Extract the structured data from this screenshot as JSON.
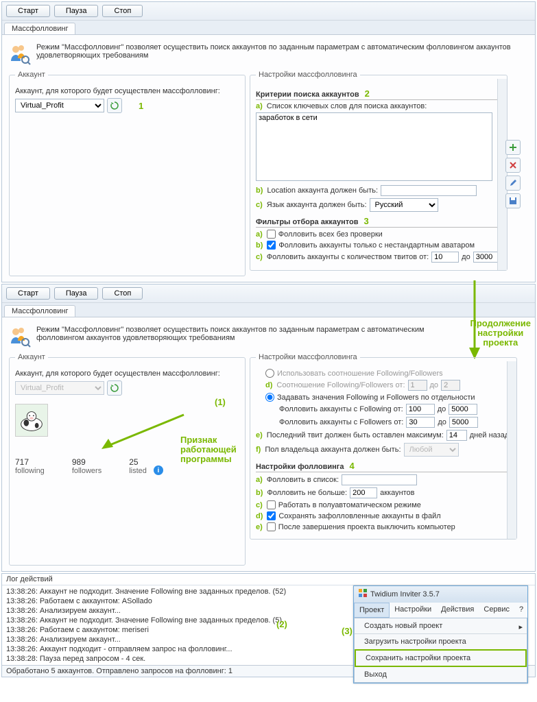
{
  "toolbar": {
    "start": "Старт",
    "pause": "Пауза",
    "stop": "Стоп"
  },
  "tabs": {
    "massfollowing": "Массфолловинг"
  },
  "intro": "Режим \"Массфолловинг\" позволяет осуществить поиск аккаунтов по заданным параметрам с автоматическим фолловингом аккаунтов удовлетворяющих требованиям",
  "account": {
    "legend": "Аккаунт",
    "prompt": "Аккаунт, для которого будет осуществлен массфолловинг:",
    "selected": "Virtual_Profit"
  },
  "settings": {
    "legend": "Настройки массфолловинга",
    "criteria_hdr": "Критерии поиска аккаунтов",
    "keywords_lbl": "Список ключевых слов для поиска аккаунтов:",
    "keywords_val": "заработок в сети",
    "location_lbl": "Location аккаунта должен быть:",
    "lang_lbl": "Язык аккаунта должен быть:",
    "lang_val": "Русский",
    "filters_hdr": "Фильтры отбора аккаунтов",
    "filt_a": "Фолловить всех без проверки",
    "filt_b": "Фолловить аккаунты только с нестандартным аватаром",
    "filt_c": "Фолловить аккаунты с количеством твитов от:",
    "from_lbl": "до",
    "tweets_from": "10",
    "tweets_to": "3000"
  },
  "settings2": {
    "ratio_opt": "Использовать соотношение Following/Followers",
    "ratio_lbl": "Соотношение Following/Followers от:",
    "ratio_from": "1",
    "ratio_to": "2",
    "separate_opt": "Задавать значения Following и Followers по отдельности",
    "following_lbl": "Фолловить аккаунты с Following от:",
    "following_from": "100",
    "following_to": "5000",
    "followers_lbl": "Фолловить аккаунты с Followers от:",
    "followers_from": "30",
    "followers_to": "5000",
    "last_tweet_lbl": "Последний твит должен быть оставлен максимум:",
    "last_tweet_days": "14",
    "days_ago": "дней назад",
    "gender_lbl": "Пол владельца аккаунта должен быть:",
    "gender_val": "Любой",
    "follow_hdr": "Настройки фолловинга",
    "list_lbl": "Фолловить в список:",
    "max_lbl": "Фолловить не больше:",
    "max_val": "200",
    "max_unit": "аккаунтов",
    "semi_auto": "Работать в полуавтоматическом режиме",
    "save_file": "Сохранять зафолловленные аккаунты в файл",
    "shutdown": "После завершения проекта выключить компьютер"
  },
  "stats": {
    "following_n": "717",
    "following_l": "following",
    "followers_n": "989",
    "followers_l": "followers",
    "listed_n": "25",
    "listed_l": "listed"
  },
  "annotations": {
    "num1": "1",
    "num2": "2",
    "num3": "3",
    "num4": "4",
    "paren1": "(1)",
    "paren2": "(2)",
    "paren3": "(3)",
    "running": "Признак\nработающей\nпрограммы",
    "continuation": "Продолжение\nнастройки\nпроекта"
  },
  "log": {
    "title": "Лог действий",
    "lines": [
      "13:38:26: Аккаунт не подходит. Значение Following вне заданных пределов. (52)",
      "13:38:26: Работаем с аккаунтом: ASollado",
      "13:38:26: Анализируем аккаунт...",
      "13:38:26: Аккаунт не подходит. Значение Following вне заданных пределов. (5)",
      "13:38:26: Работаем с аккаунтом: meriseri",
      "13:38:26: Анализируем аккаунт...",
      "13:38:26: Аккаунт подходит - отправляем запрос на фолловинг...",
      "13:38:28: Пауза перед запросом - 4 сек."
    ]
  },
  "status": "Обработано 5 аккаунтов. Отправлено запросов на фолловинг: 1",
  "popup": {
    "title": "Twidium Inviter 3.5.7",
    "menu": [
      "Проект",
      "Настройки",
      "Действия",
      "Сервис",
      "?"
    ],
    "items": {
      "new": "Создать новый проект",
      "load": "Загрузить настройки проекта",
      "save": "Сохранить настройки проекта",
      "exit": "Выход"
    }
  }
}
